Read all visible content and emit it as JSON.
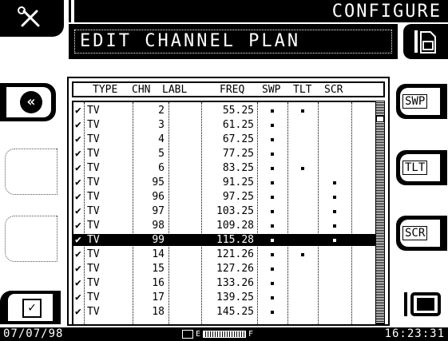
{
  "header": {
    "title": "CONFIGURE",
    "subtitle": "EDIT CHANNEL PLAN"
  },
  "icons": {
    "tools": "tools-icon",
    "document": "document-icon",
    "back": "double-chevron-left-icon",
    "check": "checkbox-icon",
    "tv": "tv-icon"
  },
  "right_buttons": {
    "swp": "SWP",
    "tlt": "TLT",
    "scr": "SCR"
  },
  "table": {
    "columns": [
      "TYPE",
      "CHN",
      "LABL",
      "FREQ",
      "SWP",
      "TLT",
      "SCR"
    ],
    "rows": [
      {
        "check": "✔",
        "type": "TV",
        "chn": "2",
        "labl": "",
        "freq": "55.25",
        "swp": true,
        "tlt": true,
        "scr": false
      },
      {
        "check": "✔",
        "type": "TV",
        "chn": "3",
        "labl": "",
        "freq": "61.25",
        "swp": true,
        "tlt": false,
        "scr": false
      },
      {
        "check": "✔",
        "type": "TV",
        "chn": "4",
        "labl": "",
        "freq": "67.25",
        "swp": true,
        "tlt": false,
        "scr": false
      },
      {
        "check": "✔",
        "type": "TV",
        "chn": "5",
        "labl": "",
        "freq": "77.25",
        "swp": true,
        "tlt": false,
        "scr": false
      },
      {
        "check": "✔",
        "type": "TV",
        "chn": "6",
        "labl": "",
        "freq": "83.25",
        "swp": true,
        "tlt": true,
        "scr": false
      },
      {
        "check": "✔",
        "type": "TV",
        "chn": "95",
        "labl": "",
        "freq": "91.25",
        "swp": true,
        "tlt": false,
        "scr": true
      },
      {
        "check": "✔",
        "type": "TV",
        "chn": "96",
        "labl": "",
        "freq": "97.25",
        "swp": true,
        "tlt": false,
        "scr": true
      },
      {
        "check": "✔",
        "type": "TV",
        "chn": "97",
        "labl": "",
        "freq": "103.25",
        "swp": true,
        "tlt": false,
        "scr": true
      },
      {
        "check": "✔",
        "type": "TV",
        "chn": "98",
        "labl": "",
        "freq": "109.28",
        "swp": true,
        "tlt": false,
        "scr": true
      },
      {
        "check": "✔",
        "type": "TV",
        "chn": "99",
        "labl": "",
        "freq": "115.28",
        "swp": true,
        "tlt": false,
        "scr": true,
        "selected": true
      },
      {
        "check": "✔",
        "type": "TV",
        "chn": "14",
        "labl": "",
        "freq": "121.26",
        "swp": true,
        "tlt": true,
        "scr": false
      },
      {
        "check": "✔",
        "type": "TV",
        "chn": "15",
        "labl": "",
        "freq": "127.26",
        "swp": true,
        "tlt": false,
        "scr": false
      },
      {
        "check": "✔",
        "type": "TV",
        "chn": "16",
        "labl": "",
        "freq": "133.26",
        "swp": true,
        "tlt": false,
        "scr": false
      },
      {
        "check": "✔",
        "type": "TV",
        "chn": "17",
        "labl": "",
        "freq": "139.25",
        "swp": true,
        "tlt": false,
        "scr": false
      },
      {
        "check": "✔",
        "type": "TV",
        "chn": "18",
        "labl": "",
        "freq": "145.25",
        "swp": true,
        "tlt": false,
        "scr": false
      }
    ]
  },
  "status": {
    "date": "07/07/98",
    "time": "16:23:31",
    "battery_empty": "E",
    "battery_full": "F"
  }
}
